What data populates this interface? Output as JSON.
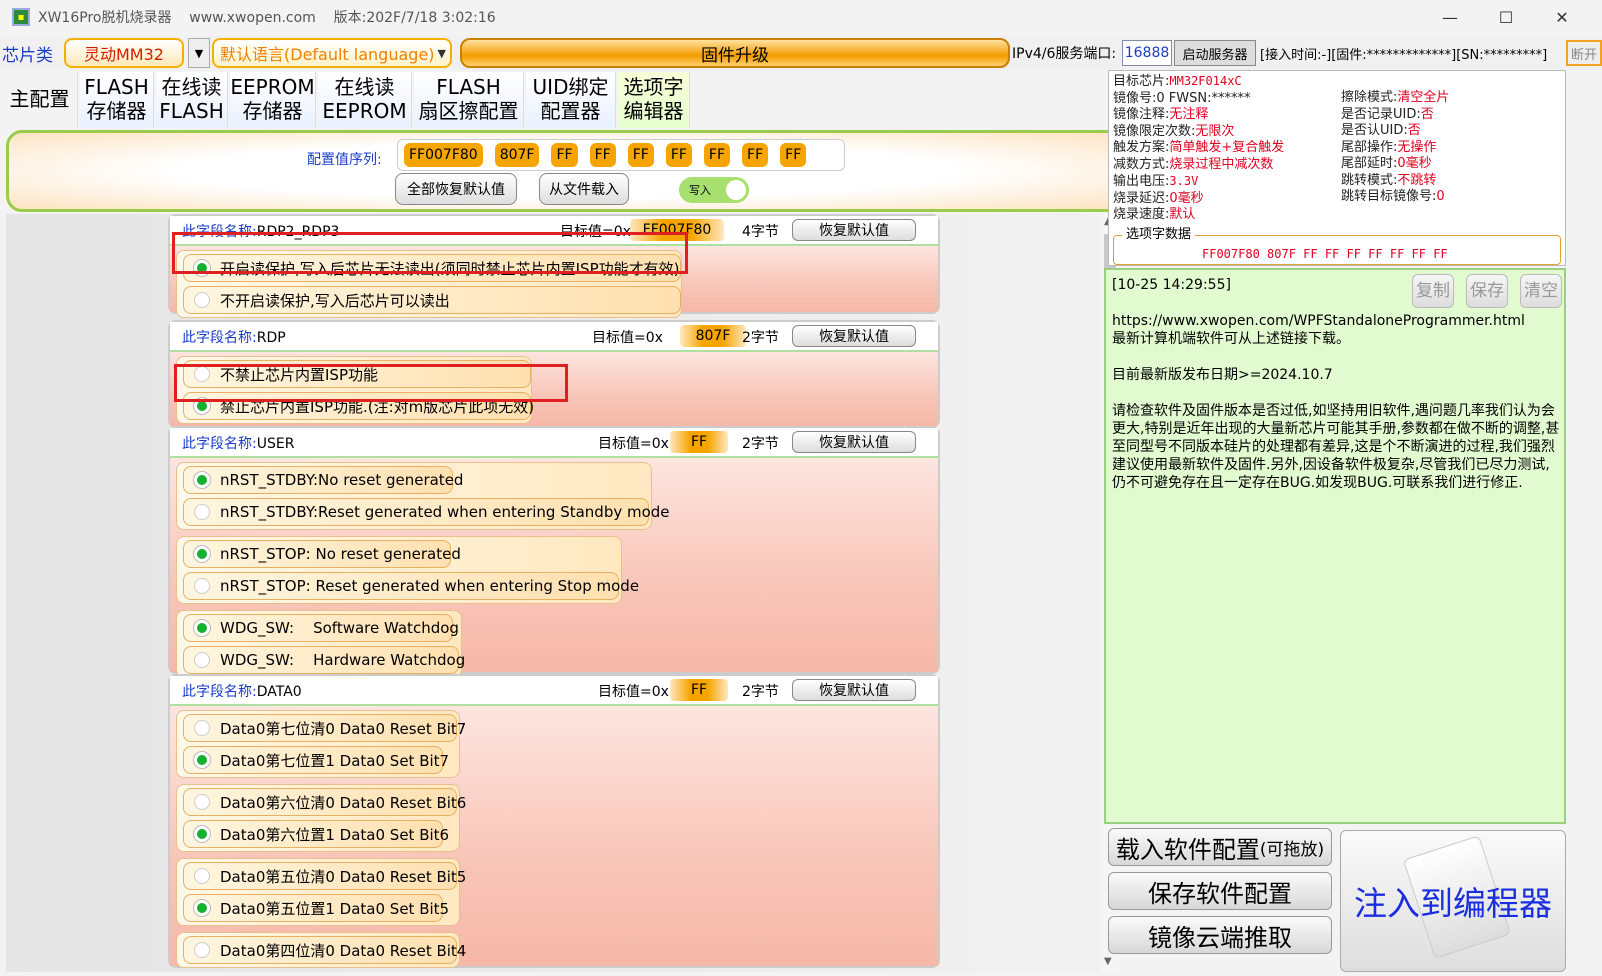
{
  "titlebar": {
    "title": "XW16Pro脱机烧录器    www.xwopen.com    版本:202F/7/18 3:02:16"
  },
  "toolbar": {
    "chip_type_label": "芯片类",
    "chip": "灵动MM32",
    "language": "默认语言(Default language)",
    "firmware_upgrade": "固件升级",
    "port_label": "IPv4/6服务端口:",
    "port": "16888",
    "start_server": "启动服务器",
    "conn_info": "[接入时间:-][固件:*************][SN:*********]",
    "disconnect": "断开"
  },
  "tabs": [
    {
      "line1": "主配置",
      "line2": ""
    },
    {
      "line1": "FLASH",
      "line2": "存储器"
    },
    {
      "line1": "在线读",
      "line2": "FLASH"
    },
    {
      "line1": "EEPROM",
      "line2": "存储器"
    },
    {
      "line1": "在线读",
      "line2": "EEPROM"
    },
    {
      "line1": "FLASH",
      "line2": "扇区擦配置"
    },
    {
      "line1": "UID绑定",
      "line2": "配置器"
    },
    {
      "line1": "选项字",
      "line2": "编辑器"
    }
  ],
  "config": {
    "seq_label": "配置值序列:",
    "values": [
      "FF007F80",
      "807F",
      "FF",
      "FF",
      "FF",
      "FF",
      "FF",
      "FF",
      "FF"
    ],
    "reset_all": "全部恢复默认值",
    "load_file": "从文件载入",
    "write_toggle": "写入"
  },
  "fields": [
    {
      "name_label": "此字段名称:",
      "name": "RDP2_RDP3",
      "target_label": "目标值=0x",
      "target": "FF007F80",
      "bytes": "4字节",
      "reset": "恢复默认值",
      "options": [
        {
          "text": "开启读保护,写入后芯片无法读出(须同时禁止芯片内置ISP功能才有效)",
          "selected": true
        },
        {
          "text": "不开启读保护,写入后芯片可以读出",
          "selected": false
        }
      ]
    },
    {
      "name_label": "此字段名称:",
      "name": "RDP",
      "target_label": "目标值=0x",
      "target": "807F",
      "bytes": "2字节",
      "reset": "恢复默认值",
      "options": [
        {
          "text": "不禁止芯片内置ISP功能",
          "selected": false
        },
        {
          "text": "禁止芯片内置ISP功能.(注:对m版芯片此项无效)",
          "selected": true
        }
      ]
    },
    {
      "name_label": "此字段名称:",
      "name": "USER",
      "target_label": "目标值=0x",
      "target": "FF",
      "bytes": "2字节",
      "reset": "恢复默认值",
      "options": [
        {
          "text": "nRST_STDBY:No reset generated",
          "selected": true
        },
        {
          "text": "nRST_STDBY:Reset generated when entering Standby mode",
          "selected": false
        },
        {
          "text": "nRST_STOP: No reset generated",
          "selected": true
        },
        {
          "text": "nRST_STOP: Reset generated when entering Stop mode",
          "selected": false
        },
        {
          "text": "WDG_SW:    Software Watchdog",
          "selected": true
        },
        {
          "text": "WDG_SW:    Hardware Watchdog",
          "selected": false
        }
      ]
    },
    {
      "name_label": "此字段名称:",
      "name": "DATA0",
      "target_label": "目标值=0x",
      "target": "FF",
      "bytes": "2字节",
      "reset": "恢复默认值",
      "options": [
        {
          "text": "Data0第七位清0 Data0 Reset Bit7",
          "selected": false
        },
        {
          "text": "Data0第七位置1 Data0 Set Bit7",
          "selected": true
        },
        {
          "text": "Data0第六位清0 Data0 Reset Bit6",
          "selected": false
        },
        {
          "text": "Data0第六位置1 Data0 Set Bit6",
          "selected": true
        },
        {
          "text": "Data0第五位清0 Data0 Reset Bit5",
          "selected": false
        },
        {
          "text": "Data0第五位置1 Data0 Set Bit5",
          "selected": true
        },
        {
          "text": "Data0第四位清0 Data0 Reset Bit4",
          "selected": false
        }
      ]
    }
  ],
  "info": {
    "left": [
      {
        "k": "目标芯片:",
        "v": "MM32F014xC",
        "mono": true
      },
      {
        "k": "镜像号:",
        "v": "0 FWSN:******",
        "mono": false,
        "dark": true
      },
      {
        "k": "镜像注释:",
        "v": "无注释"
      },
      {
        "k": "镜像限定次数:",
        "v": "无限次"
      },
      {
        "k": "触发方案:",
        "v": "简单触发+复合触发"
      },
      {
        "k": "减数方式:",
        "v": "烧录过程中减次数"
      },
      {
        "k": "输出电压:",
        "v": "3.3V",
        "mono": true
      },
      {
        "k": "烧录延迟:",
        "v": "0毫秒"
      },
      {
        "k": "烧录速度:",
        "v": "默认"
      }
    ],
    "right": [
      {
        "k": "擦除模式:",
        "v": "清空全片"
      },
      {
        "k": "是否记录UID:",
        "v": "否"
      },
      {
        "k": "是否认UID:",
        "v": "否"
      },
      {
        "k": "尾部操作:",
        "v": "无操作"
      },
      {
        "k": "尾部延时:",
        "v": "0毫秒"
      },
      {
        "k": "跳转模式:",
        "v": "不跳转"
      },
      {
        "k": "跳转目标镜像号:",
        "v": "0"
      }
    ],
    "option_legend": "选项字数据",
    "option_data": "FF007F80 807F FF FF FF FF FF FF FF"
  },
  "log": {
    "timestamp": "[10-25 14:29:55]",
    "copy": "复制",
    "save": "保存",
    "clear": "清空",
    "text": "https://www.xwopen.com/WPFStandaloneProgrammer.html\n最新计算机端软件可从上述链接下载。\n\n目前最新版发布日期>=2024.10.7\n\n请检查软件及固件版本是否过低,如坚持用旧软件,遇问题几率我们认为会更大,特别是近年出现的大量新芯片可能其手册,参数都在做不断的调整,甚至同型号不同版本硅片的处理都有差异,这是个不断演进的过程,我们强烈建议使用最新软件及固件.另外,因设备软件极复杂,尽管我们已尽力测试,仍不可避免存在且一定存在BUG.如发现BUG.可联系我们进行修正."
  },
  "actions": {
    "load_config": "载入软件配置",
    "load_config_note": "(可拖放)",
    "save_config": "保存软件配置",
    "cloud_pull": "镜像云端推取",
    "inject": "注入到编程器"
  }
}
